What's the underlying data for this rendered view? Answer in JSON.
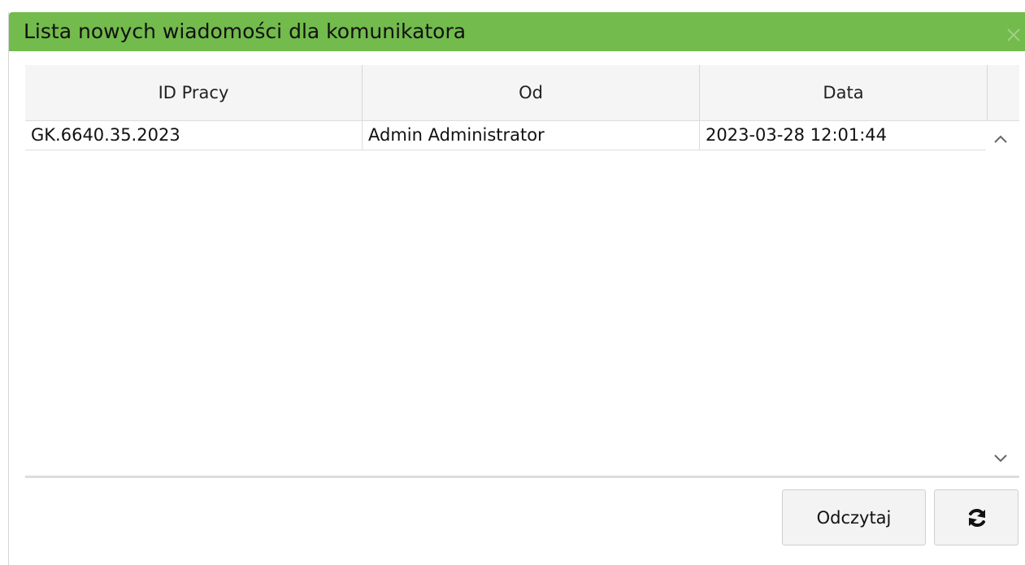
{
  "dialog": {
    "title": "Lista nowych wiadomości dla komunikatora",
    "title_bar_color": "#72bb4c",
    "close_icon": "close-icon"
  },
  "grid": {
    "columns": [
      "ID Pracy",
      "Od",
      "Data"
    ],
    "rows": [
      {
        "id_pracy": "GK.6640.35.2023",
        "od": "Admin Administrator",
        "data": "2023-03-28 12:01:44"
      }
    ],
    "scroll_up_icon": "chevron-up-icon",
    "scroll_down_icon": "chevron-down-icon"
  },
  "buttons": {
    "read_label": "Odczytaj",
    "refresh_icon": "refresh-icon"
  }
}
